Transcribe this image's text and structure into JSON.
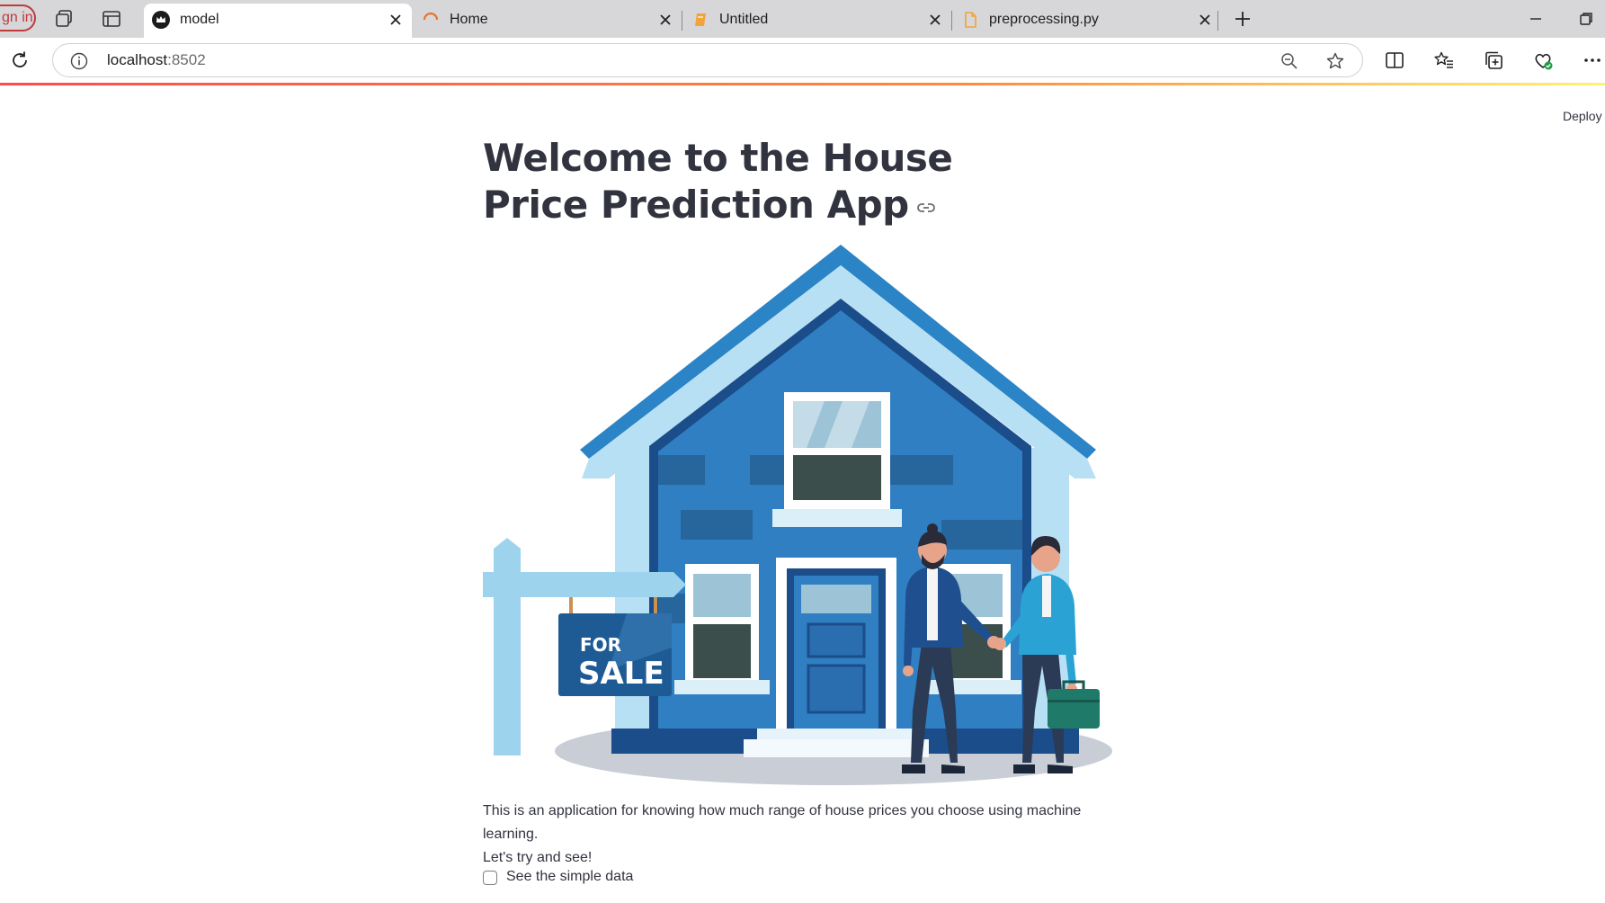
{
  "browser": {
    "signin_label": "gn in",
    "tabs": [
      {
        "title": "model",
        "active": true
      },
      {
        "title": "Home",
        "active": false
      },
      {
        "title": "Untitled",
        "active": false
      },
      {
        "title": "preprocessing.py",
        "active": false
      }
    ],
    "address": {
      "host": "localhost",
      "port": ":8502"
    }
  },
  "app": {
    "deploy_label": "Deploy",
    "title": "Welcome to the House Price Prediction App",
    "hero_image": {
      "sign_text_line1": "FOR",
      "sign_text_line2": "SALE"
    },
    "description_line1": "This is an application for knowing how much range of house prices you choose using machine learning.",
    "description_line2": "Let's try and see!",
    "checkbox_label": "See the simple data"
  },
  "colors": {
    "accent": "#ff4b4b",
    "text": "#31333f",
    "house_blue": "#2a7fc1",
    "house_dark": "#1a4f8f",
    "house_light": "#b8dff3"
  }
}
